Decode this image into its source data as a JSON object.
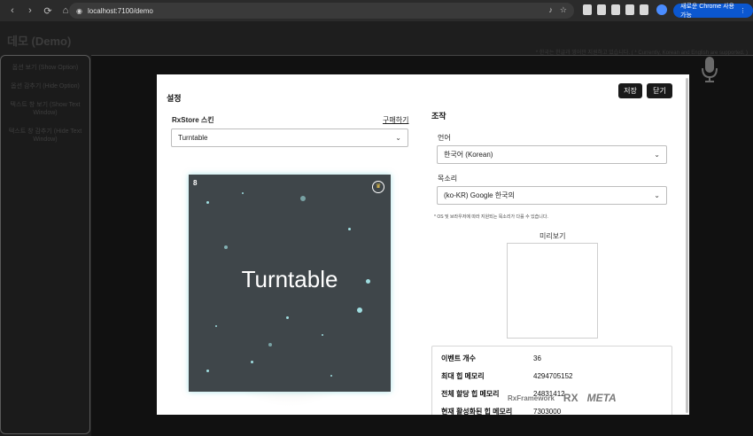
{
  "browser": {
    "url": "localhost:7100/demo",
    "update_button": "새로운 Chrome 사용 가능"
  },
  "page": {
    "title": "데모 (Demo)",
    "notice": "* 한국는 한글과 영어만 지원하고 있습니다. ( * Currently, Korean and English are supported. )"
  },
  "sidebar": {
    "items": [
      "옵션 보기 (Show Option)",
      "옵션 감추기 (Hide Option)",
      "텍스트 창 보기 (Show Text Window)",
      "텍스트 창 감추기 (Hide Text Window)"
    ]
  },
  "modal": {
    "title": "설정",
    "save_label": "저장",
    "close_label": "닫기",
    "skin_label": "RxStore 스킨",
    "buy_label": "구매하기",
    "skin_value": "Turntable",
    "cover": {
      "number": "8",
      "title": "Turntable"
    },
    "controls_title": "조작",
    "language_label": "언어",
    "language_value": "한국어 (Korean)",
    "voice_label": "목소리",
    "voice_value": "(ko-KR) Google 한국의",
    "hint": "* OS 및 브라우저에 따라 지원되는 목소리가 다를 수 있습니다.",
    "preview_label": "미리보기",
    "stats": [
      {
        "label": "이벤트 개수",
        "value": "36"
      },
      {
        "label": "최대 힙 메모리",
        "value": "4294705152"
      },
      {
        "label": "전체 할당 힙 메모리",
        "value": "24831412"
      },
      {
        "label": "현재 활성화된 힙 메모리",
        "value": "7303000"
      }
    ],
    "logos": [
      "RxFramework",
      "RX",
      "META"
    ]
  }
}
